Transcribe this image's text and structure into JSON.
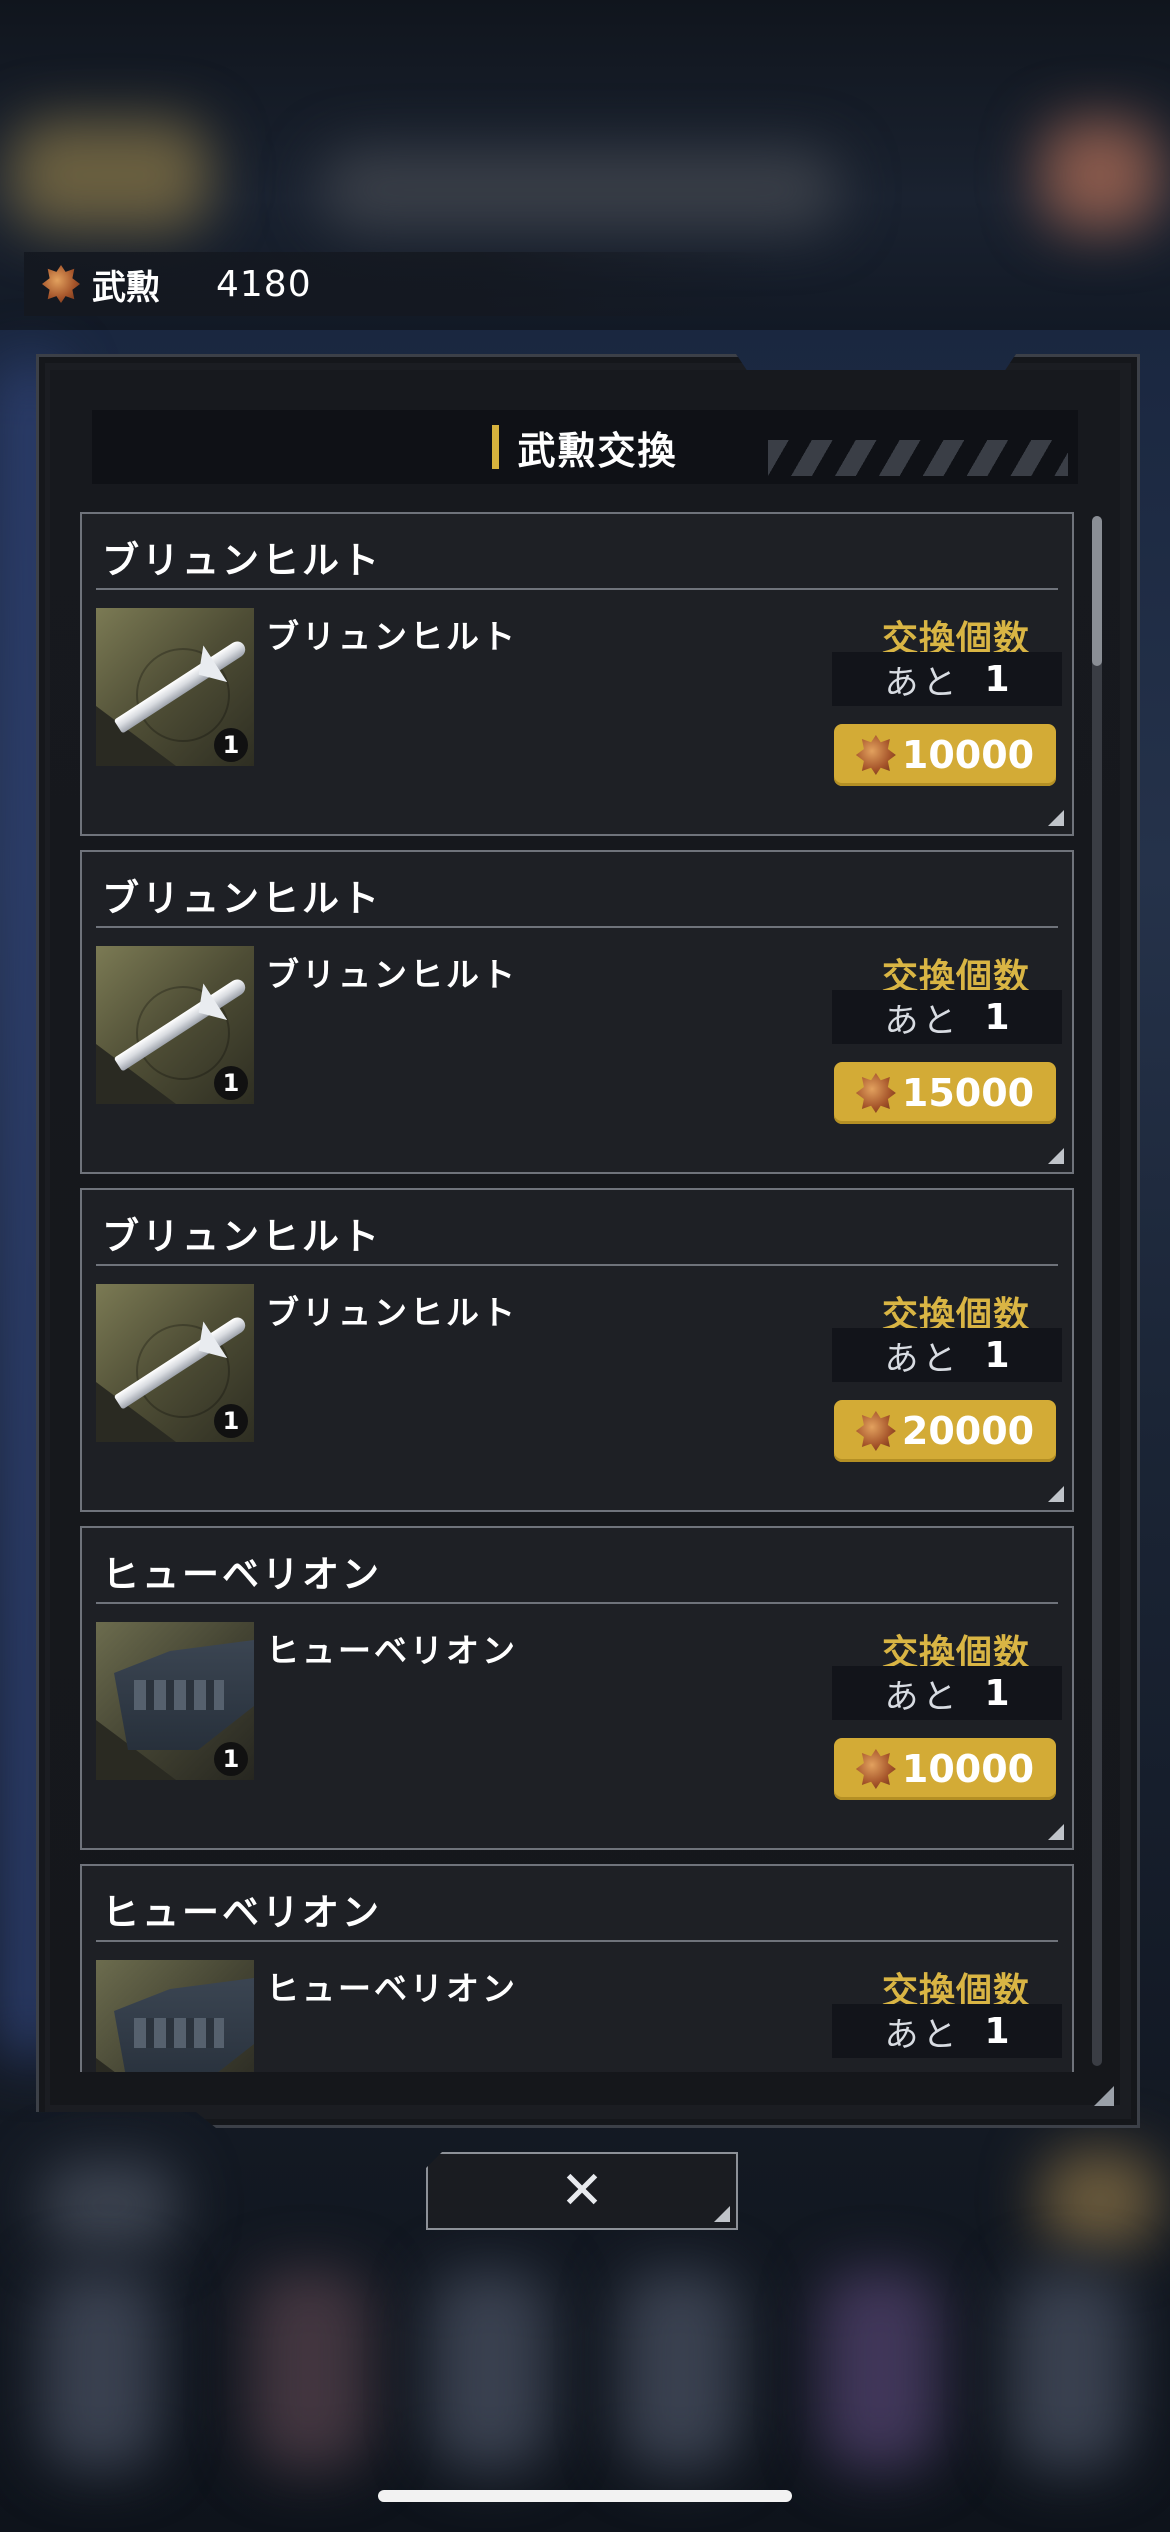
{
  "currency": {
    "label": "武勲",
    "amount": "4180"
  },
  "dialog": {
    "title": "武勲交換"
  },
  "labels": {
    "exchange_count": "交換個数",
    "remaining": "あと"
  },
  "items": [
    {
      "name": "ブリュンヒルト",
      "subname": "ブリュンヒルト",
      "qty": "1",
      "remaining": "1",
      "cost": "10000",
      "thumb": "missile"
    },
    {
      "name": "ブリュンヒルト",
      "subname": "ブリュンヒルト",
      "qty": "1",
      "remaining": "1",
      "cost": "15000",
      "thumb": "missile"
    },
    {
      "name": "ブリュンヒルト",
      "subname": "ブリュンヒルト",
      "qty": "1",
      "remaining": "1",
      "cost": "20000",
      "thumb": "missile"
    },
    {
      "name": "ヒューベリオン",
      "subname": "ヒューベリオン",
      "qty": "1",
      "remaining": "1",
      "cost": "10000",
      "thumb": "ship"
    },
    {
      "name": "ヒューベリオン",
      "subname": "ヒューベリオン",
      "qty": "",
      "remaining": "1",
      "cost": "",
      "thumb": "ship"
    }
  ],
  "close": {
    "symbol": "✕"
  },
  "colors": {
    "accent_gold": "#d3ab36",
    "label_gold": "#d9b544"
  }
}
